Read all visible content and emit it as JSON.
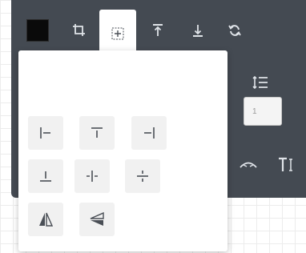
{
  "toolbar": {
    "buttons": [
      {
        "name": "color-swatch",
        "icon": "color-swatch",
        "color": "#0a0a0a"
      },
      {
        "name": "crop",
        "icon": "crop-icon"
      },
      {
        "name": "align",
        "icon": "align-center-icon",
        "active": true
      },
      {
        "name": "bring-to-front",
        "icon": "bring-to-front-icon"
      },
      {
        "name": "send-to-back",
        "icon": "send-to-back-icon"
      },
      {
        "name": "flip",
        "icon": "rotate-icon"
      }
    ],
    "line_height_value": "1"
  },
  "align_popover": {
    "buttons": [
      {
        "name": "align-left",
        "icon": "align-left-icon"
      },
      {
        "name": "align-top",
        "icon": "align-top-icon"
      },
      {
        "name": "align-right",
        "icon": "align-right-icon"
      },
      {
        "name": "align-bottom",
        "icon": "align-bottom-icon"
      },
      {
        "name": "align-horizontal-center",
        "icon": "align-horizontal-center-icon"
      },
      {
        "name": "align-vertical-center",
        "icon": "align-vertical-center-icon"
      },
      {
        "name": "flip-horizontal",
        "icon": "flip-horizontal-icon"
      },
      {
        "name": "flip-vertical",
        "icon": "flip-vertical-icon"
      }
    ]
  },
  "colors": {
    "toolbar_bg": "#444a52",
    "icon_light": "#dfe3e8",
    "icon_dark": "#4a4f56",
    "button_bg": "#f1f1f1"
  }
}
